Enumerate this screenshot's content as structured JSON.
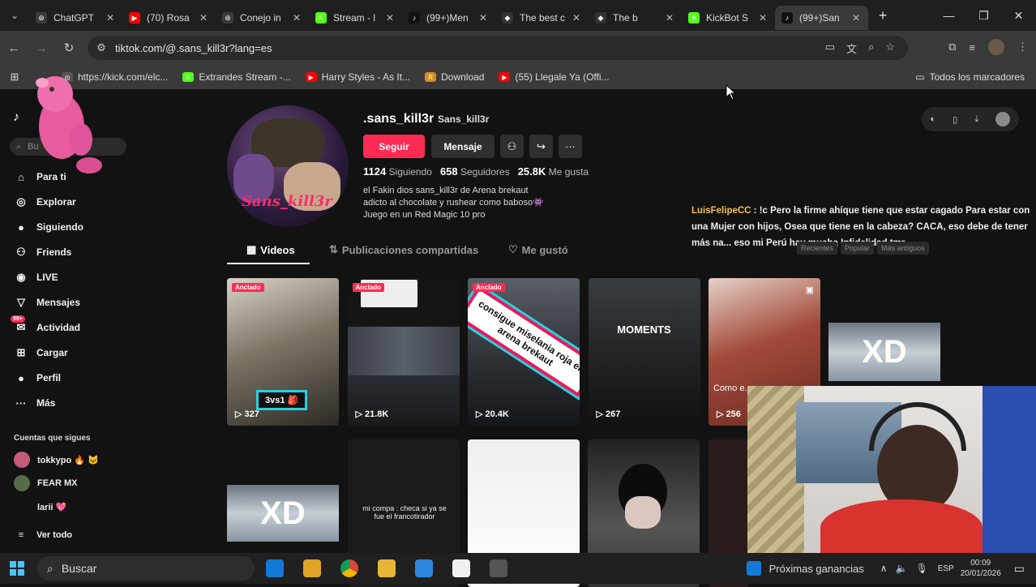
{
  "tabs": [
    {
      "title": "ChatGPT",
      "color": "#3a3a3a",
      "glyph": "⊛"
    },
    {
      "title": "(70) Rosa",
      "color": "#ff0000",
      "glyph": "▶"
    },
    {
      "title": "Conejo in",
      "color": "#3a3a3a",
      "glyph": "⊛"
    },
    {
      "title": "Stream - l",
      "color": "#53fc18",
      "glyph": "K"
    },
    {
      "title": "(99+)Men",
      "color": "#111111",
      "glyph": "♪"
    },
    {
      "title": "The best c",
      "color": "#333333",
      "glyph": "◆"
    },
    {
      "title": "The b",
      "color": "#333333",
      "glyph": "◆"
    },
    {
      "title": "KickBot S",
      "color": "#53fc18",
      "glyph": "✕"
    },
    {
      "title": "(99+)San",
      "color": "#111111",
      "glyph": "♪"
    }
  ],
  "address": {
    "url": "tiktok.com/@.sans_kill3r?lang=es"
  },
  "bookmarks": [
    {
      "label": "https://kick.com/elc...",
      "color": "#555555",
      "glyph": "◎"
    },
    {
      "label": "Extrandes Stream -...",
      "color": "#53fc18",
      "glyph": "K"
    },
    {
      "label": "Harry Styles - As It...",
      "color": "#ff0000",
      "glyph": "▶"
    },
    {
      "label": "Download",
      "color": "#d98c1a",
      "glyph": "R"
    },
    {
      "label": "(55) Llegale Ya (Offi...",
      "color": "#ff0000",
      "glyph": "▶"
    }
  ],
  "all_bookmarks": "Todos los marcadores",
  "sidebar": {
    "search_placeholder": "Bu",
    "items": [
      {
        "label": "Para ti",
        "icon": "home-icon"
      },
      {
        "label": "Explorar",
        "icon": "compass-icon"
      },
      {
        "label": "Siguiendo",
        "icon": "following-avatar-icon"
      },
      {
        "label": "Friends",
        "icon": "friends-icon"
      },
      {
        "label": "LIVE",
        "icon": "live-icon"
      },
      {
        "label": "Mensajes",
        "icon": "send-icon"
      },
      {
        "label": "Actividad",
        "icon": "inbox-icon",
        "badge": "99+"
      },
      {
        "label": "Cargar",
        "icon": "upload-icon"
      },
      {
        "label": "Perfil",
        "icon": "profile-icon"
      },
      {
        "label": "Más",
        "icon": "more-icon"
      }
    ],
    "following_title": "Cuentas que sigues",
    "following": [
      {
        "name": "tokkypo 🔥 🐱",
        "color": "#c45a7a"
      },
      {
        "name": "FEAR MX",
        "color": "#556b4a"
      },
      {
        "name": "larii 💖",
        "color": "#121212"
      }
    ],
    "see_all": "Ver todo"
  },
  "profile": {
    "username": ".sans_kill3r",
    "nickname": "Sans_kill3r",
    "avatar_text": "Sans_kill3r",
    "follow_label": "Seguir",
    "message_label": "Mensaje",
    "stats": [
      {
        "value": "1124",
        "label": "Siguiendo"
      },
      {
        "value": "658",
        "label": "Seguidores"
      },
      {
        "value": "25.8K",
        "label": "Me gusta"
      }
    ],
    "bio": [
      "el Fakin dios sans_kill3r de Arena brekaut",
      "adicto al chocolate y rushear como baboso👾",
      "Juego en un Red Magic 10 pro"
    ]
  },
  "chat_overlay": {
    "user": "LuisFelipeCC",
    "message": " : !c Pero la firme ahíque tiene que estar cagado Para estar con una Mujer con hijos, Osea que tiene en la cabeza? CACA, eso debe de tener más na... eso mi Perú hay mucha Infidelidad tmr"
  },
  "content_tabs": [
    "Videos",
    "Publicaciones compartidas",
    "Me gustó"
  ],
  "sort_buttons": [
    "Recientes",
    "Popular",
    "Más antiguos"
  ],
  "videos": [
    {
      "views": "327",
      "pinned": "Anclado",
      "overlay": "3vs1 🎒",
      "bg": "linear-gradient(160deg,#d8d2c8,#7d7566 45%,#2d2a26)"
    },
    {
      "views": "21.8K",
      "pinned": "Anclado",
      "overlay": "",
      "bg": "linear-gradient(180deg,#141414 30%,#2c3038 60%,#1a1a1a)"
    },
    {
      "views": "20.4K",
      "pinned": "Anclado",
      "overlay": "consigue miselania roja en arena brekaut",
      "bg": "linear-gradient(180deg,#5a5f66,#2b2e33 60%,#15161a)"
    },
    {
      "views": "267",
      "pinned": "",
      "overlay": "MOMENTS",
      "bg": "linear-gradient(180deg,#3a3d40,#1f2123 60%,#111)"
    },
    {
      "views": "256",
      "pinned": "",
      "overlay": "Como e...",
      "bg": "linear-gradient(160deg,#e6d2c8,#a34a3a 45%,#6b2a22)"
    }
  ],
  "row2": [
    {
      "text": "XD"
    },
    {
      "text": "mi compa : checa si ya se fue el francotirador"
    },
    {
      "text": ""
    },
    {
      "text": ""
    }
  ],
  "xd_label": "XD",
  "taskbar": {
    "search": "Buscar",
    "apps": [
      {
        "name": "outlook-app-icon",
        "color": "#1479d6"
      },
      {
        "name": "medal-app-icon",
        "color": "#e0a526"
      },
      {
        "name": "chrome-app-icon",
        "color": "#4a9e4a"
      },
      {
        "name": "file-explorer-app-icon",
        "color": "#e6b537"
      },
      {
        "name": "store-app-icon",
        "color": "#2e86de"
      },
      {
        "name": "capcut-app-icon",
        "color": "#f0f0f0"
      },
      {
        "name": "obs-app-icon",
        "color": "#555555"
      }
    ],
    "widget": "Próximas ganancias",
    "lang": "ESP",
    "time": "00:09",
    "date": "20/01/2026"
  }
}
